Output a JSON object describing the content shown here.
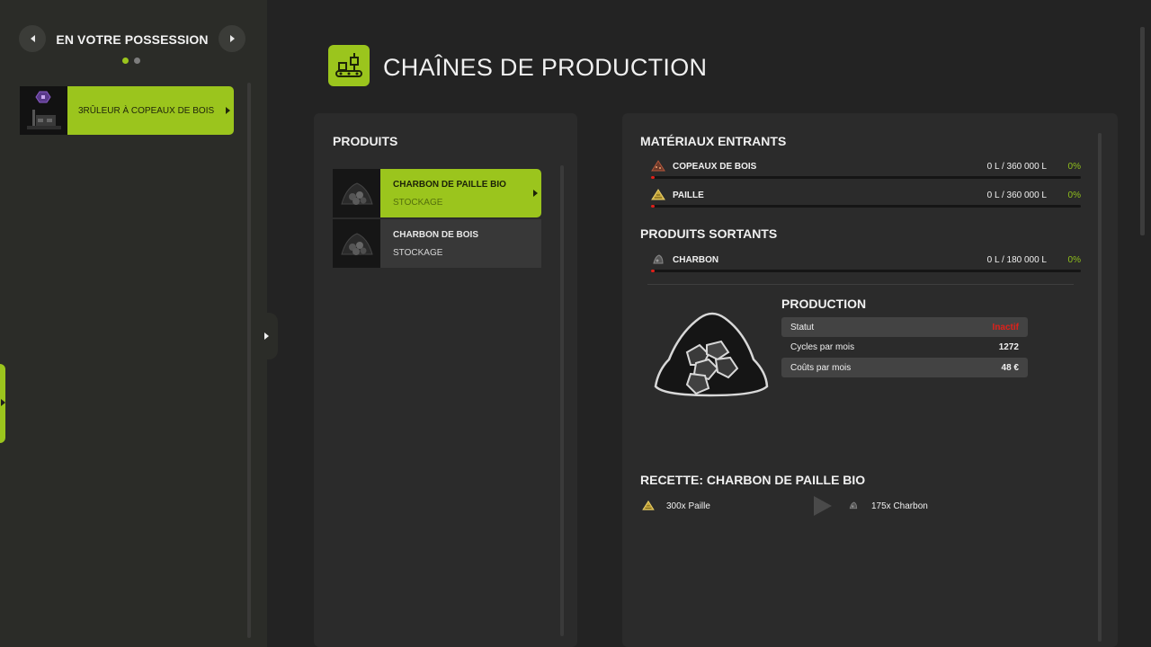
{
  "sidebar": {
    "title": "EN VOTRE POSSESSION",
    "pages": 2,
    "active_page": 1,
    "items": [
      {
        "label": "3RÛLEUR À COPEAUX DE BOIS",
        "selected": true
      }
    ]
  },
  "header": {
    "title": "CHAÎNES DE PRODUCTION",
    "icon": "production-chain-icon"
  },
  "products": {
    "title": "PRODUITS",
    "items": [
      {
        "name": "CHARBON DE PAILLE BIO",
        "sub": "STOCKAGE",
        "icon": "coal-pile-icon",
        "selected": true
      },
      {
        "name": "CHARBON DE BOIS",
        "sub": "STOCKAGE",
        "icon": "coal-pile-icon",
        "selected": false
      }
    ]
  },
  "inputs": {
    "title": "MATÉRIAUX ENTRANTS",
    "items": [
      {
        "name": "COPEAUX DE BOIS",
        "amount": "0 L / 360 000 L",
        "percent": "0%",
        "icon": "woodchips-icon",
        "fill": 0
      },
      {
        "name": "PAILLE",
        "amount": "0 L / 360 000 L",
        "percent": "0%",
        "icon": "straw-icon",
        "fill": 0
      }
    ]
  },
  "outputs": {
    "title": "PRODUITS SORTANTS",
    "items": [
      {
        "name": "CHARBON",
        "amount": "0 L / 180 000 L",
        "percent": "0%",
        "icon": "coal-icon",
        "fill": 0
      }
    ]
  },
  "production": {
    "title": "PRODUCTION",
    "status_label": "Statut",
    "status_value": "Inactif",
    "cycles_label": "Cycles par mois",
    "cycles_value": "1272",
    "costs_label": "Coûts par mois",
    "costs_value": "48 €"
  },
  "recipe": {
    "title": "RECETTE: CHARBON DE PAILLE BIO",
    "input": "300x Paille",
    "output": "175x Charbon"
  },
  "colors": {
    "accent": "#9bc51d",
    "inactive": "#e0201a",
    "percent": "#8fbf1c",
    "background": "#232323"
  }
}
